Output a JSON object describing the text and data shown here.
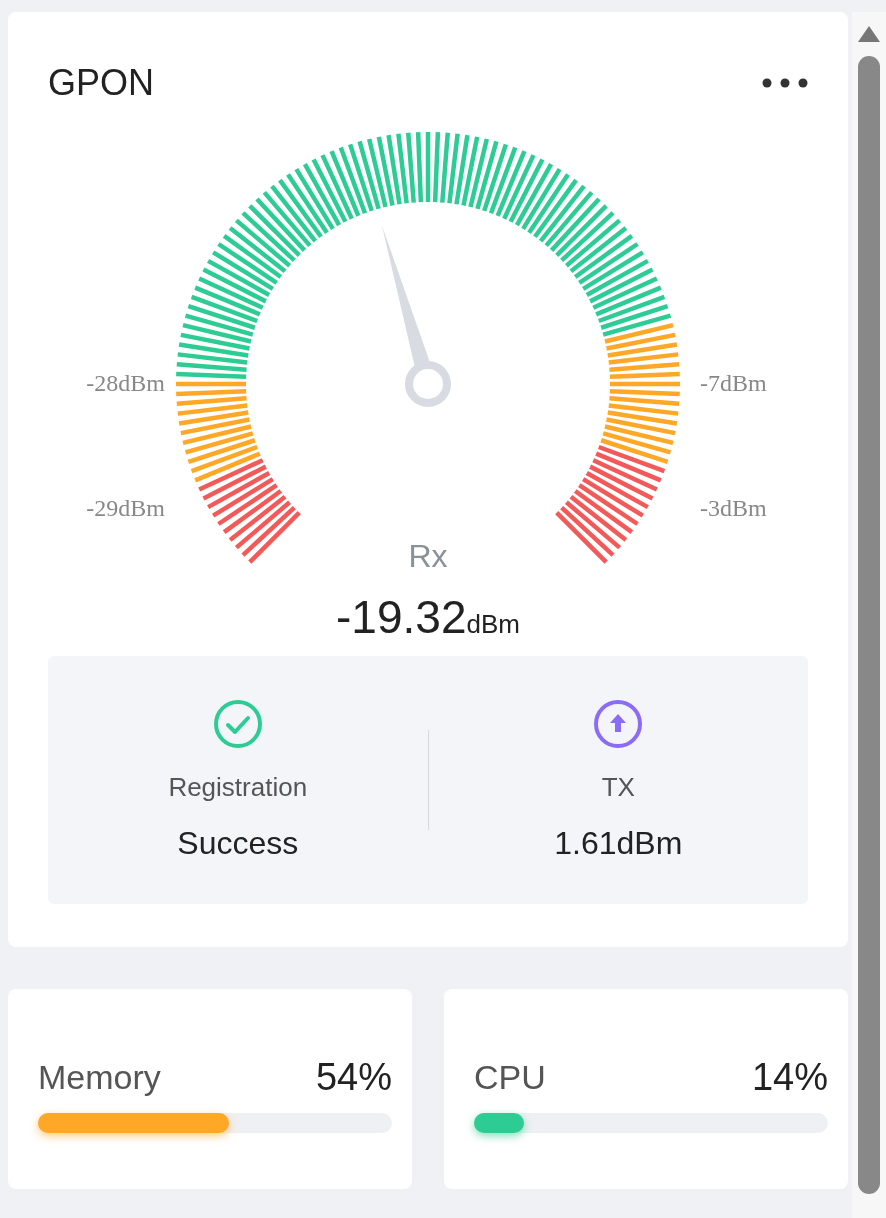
{
  "gpon": {
    "title": "GPON",
    "gauge": {
      "level": 0.44,
      "scale_labels": [
        "-28dBm",
        "-29dBm",
        "-7dBm",
        "-3dBm"
      ],
      "label": "Rx",
      "value": "-19.32",
      "unit": "dBm"
    },
    "stats": [
      {
        "kind": "registration",
        "label": "Registration",
        "value": "Success"
      },
      {
        "kind": "tx",
        "label": "TX",
        "value": "1.61dBm"
      }
    ]
  },
  "usage": [
    {
      "label": "Memory",
      "value": "54%",
      "level": 0.54,
      "color": "#ffa726"
    },
    {
      "label": "CPU",
      "value": "14%",
      "level": 0.14,
      "color": "#2ecc95"
    }
  ]
}
